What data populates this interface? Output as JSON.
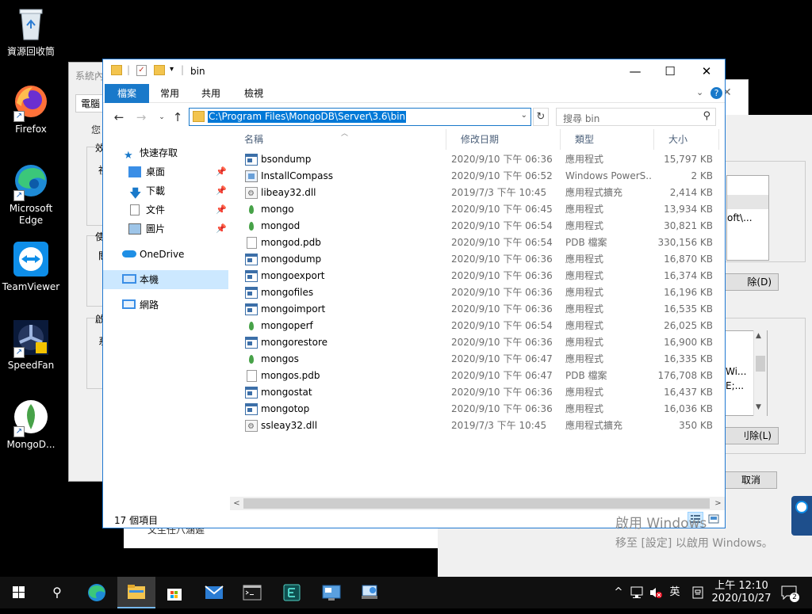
{
  "desktop": {
    "icons": [
      {
        "label": "資源回收筒",
        "icon": "recycle-bin-icon"
      },
      {
        "label": "Firefox",
        "icon": "firefox-icon"
      },
      {
        "label": "Microsoft Edge",
        "icon": "edge-icon"
      },
      {
        "label": "TeamViewer",
        "icon": "teamviewer-icon"
      },
      {
        "label": "SpeedFan",
        "icon": "speedfan-icon"
      },
      {
        "label": "MongoD...",
        "icon": "mongodb-icon"
      }
    ]
  },
  "background_windows": {
    "sysprops_title": "系統內",
    "sysprops_tab": "電腦",
    "sysprops_labels": [
      "您",
      "效",
      "使",
      "啟"
    ],
    "sysprops_sub": [
      "視",
      "關",
      "系"
    ],
    "envvars": {
      "path_snippet": "oft\\...",
      "delete_button_top": "除(D)",
      "list_snippets": [
        "Wi...",
        "E;..."
      ],
      "delete_button_bottom": "刂除(L)",
      "cancel_button": "取消",
      "close_glyph": "✕"
    },
    "bottom_snippet": "文生任八涵遲"
  },
  "explorer": {
    "title": "bin",
    "ribbon_tabs": [
      "檔案",
      "常用",
      "共用",
      "檢視"
    ],
    "address_path": "C:\\Program Files\\MongoDB\\Server\\3.6\\bin",
    "search_placeholder": "搜尋 bin",
    "nav": {
      "quick_access": "快速存取",
      "desktop": "桌面",
      "downloads": "下載",
      "documents": "文件",
      "pictures": "圖片",
      "onedrive": "OneDrive",
      "this_pc": "本機",
      "network": "網路"
    },
    "columns": {
      "name": "名稱",
      "date": "修改日期",
      "type": "類型",
      "size": "大小"
    },
    "files": [
      {
        "name": "bsondump",
        "date": "2020/9/10 下午 06:36",
        "type": "應用程式",
        "size": "15,797 KB",
        "icon": "exe"
      },
      {
        "name": "InstallCompass",
        "date": "2020/9/10 下午 06:52",
        "type": "Windows PowerS...",
        "size": "2 KB",
        "icon": "compass"
      },
      {
        "name": "libeay32.dll",
        "date": "2019/7/3 下午 10:45",
        "type": "應用程式擴充",
        "size": "2,414 KB",
        "icon": "dll"
      },
      {
        "name": "mongo",
        "date": "2020/9/10 下午 06:45",
        "type": "應用程式",
        "size": "13,934 KB",
        "icon": "mongo"
      },
      {
        "name": "mongod",
        "date": "2020/9/10 下午 06:54",
        "type": "應用程式",
        "size": "30,821 KB",
        "icon": "mongo"
      },
      {
        "name": "mongod.pdb",
        "date": "2020/9/10 下午 06:54",
        "type": "PDB 檔案",
        "size": "330,156 KB",
        "icon": "pdb"
      },
      {
        "name": "mongodump",
        "date": "2020/9/10 下午 06:36",
        "type": "應用程式",
        "size": "16,870 KB",
        "icon": "exe"
      },
      {
        "name": "mongoexport",
        "date": "2020/9/10 下午 06:36",
        "type": "應用程式",
        "size": "16,374 KB",
        "icon": "exe"
      },
      {
        "name": "mongofiles",
        "date": "2020/9/10 下午 06:36",
        "type": "應用程式",
        "size": "16,196 KB",
        "icon": "exe"
      },
      {
        "name": "mongoimport",
        "date": "2020/9/10 下午 06:36",
        "type": "應用程式",
        "size": "16,535 KB",
        "icon": "exe"
      },
      {
        "name": "mongoperf",
        "date": "2020/9/10 下午 06:54",
        "type": "應用程式",
        "size": "26,025 KB",
        "icon": "mongo"
      },
      {
        "name": "mongorestore",
        "date": "2020/9/10 下午 06:36",
        "type": "應用程式",
        "size": "16,900 KB",
        "icon": "exe"
      },
      {
        "name": "mongos",
        "date": "2020/9/10 下午 06:47",
        "type": "應用程式",
        "size": "16,335 KB",
        "icon": "mongo"
      },
      {
        "name": "mongos.pdb",
        "date": "2020/9/10 下午 06:47",
        "type": "PDB 檔案",
        "size": "176,708 KB",
        "icon": "pdb"
      },
      {
        "name": "mongostat",
        "date": "2020/9/10 下午 06:36",
        "type": "應用程式",
        "size": "16,437 KB",
        "icon": "exe"
      },
      {
        "name": "mongotop",
        "date": "2020/9/10 下午 06:36",
        "type": "應用程式",
        "size": "16,036 KB",
        "icon": "exe"
      },
      {
        "name": "ssleay32.dll",
        "date": "2019/7/3 下午 10:45",
        "type": "應用程式擴充",
        "size": "350 KB",
        "icon": "dll"
      }
    ],
    "status": "17 個項目"
  },
  "watermark": {
    "line1": "啟用 Windows",
    "line2": "移至 [設定] 以啟用 Windows。"
  },
  "taskbar": {
    "time": "上午 12:10",
    "date": "2020/10/27",
    "ime": "英",
    "notification_count": "2"
  },
  "colors": {
    "accent": "#1979ca",
    "selection": "#0078d7",
    "nav_selected": "#cce8ff"
  }
}
